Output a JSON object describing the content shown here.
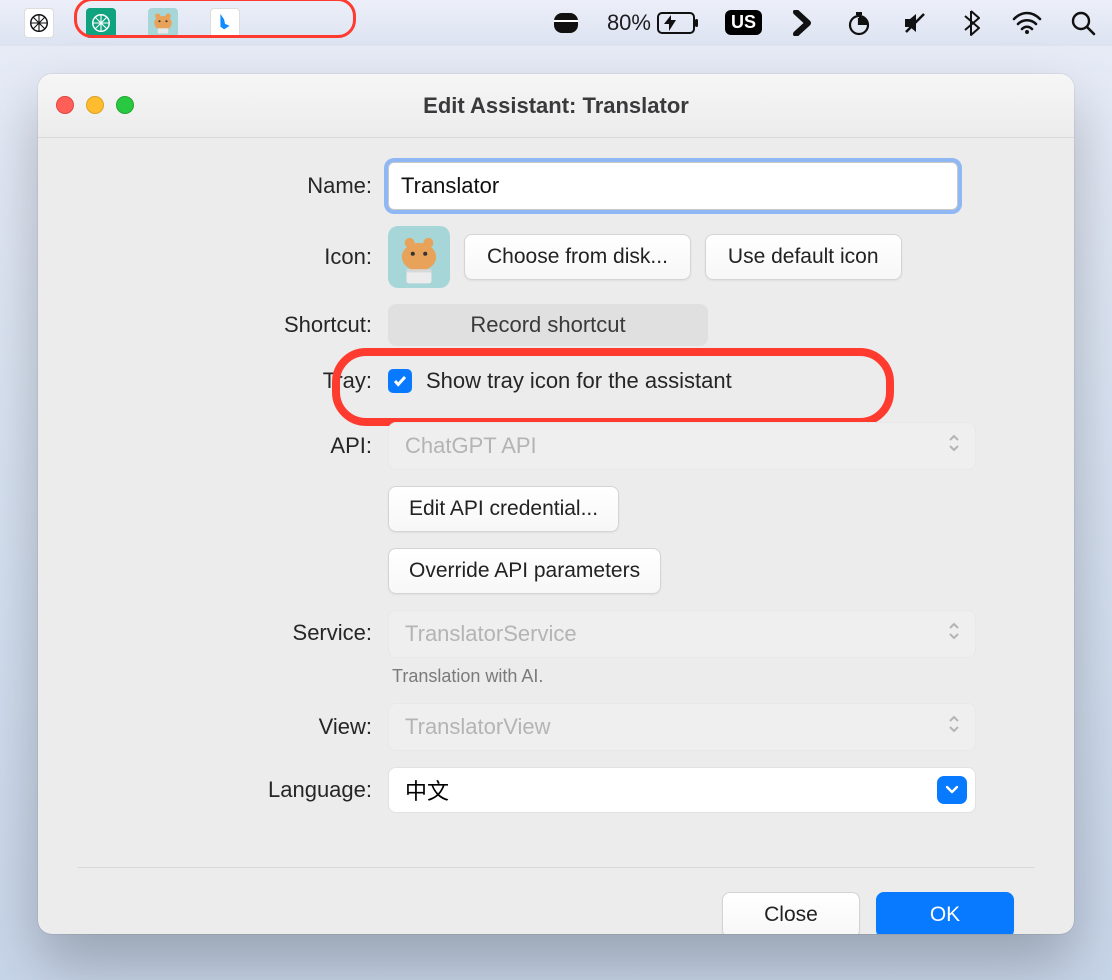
{
  "menubar": {
    "battery_percent": "80%",
    "input_source": "US",
    "tray_icons": [
      "openai-white",
      "openai-green",
      "hamster-teal",
      "bing-white"
    ]
  },
  "window": {
    "title": "Edit Assistant: Translator",
    "labels": {
      "name": "Name:",
      "icon": "Icon:",
      "shortcut": "Shortcut:",
      "tray": "Tray:",
      "api": "API:",
      "service": "Service:",
      "view": "View:",
      "language": "Language:"
    },
    "name_value": "Translator",
    "choose_from_disk": "Choose from disk...",
    "use_default_icon": "Use default icon",
    "record_shortcut": "Record shortcut",
    "tray_checkbox": "Show tray icon for the assistant",
    "tray_checked": true,
    "api_value": "ChatGPT API",
    "edit_api": "Edit API credential...",
    "override_api": "Override API parameters",
    "service_value": "TranslatorService",
    "service_caption": "Translation with AI.",
    "view_value": "TranslatorView",
    "language_value": "中文",
    "close": "Close",
    "ok": "OK"
  }
}
